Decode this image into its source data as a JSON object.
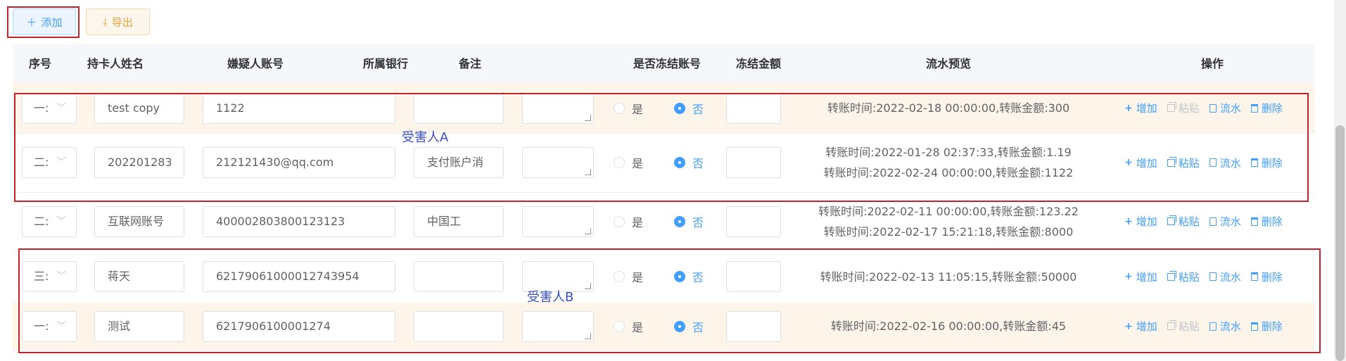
{
  "toolbar": {
    "add_label": "添加",
    "export_label": "导出"
  },
  "table": {
    "headers": {
      "index": "序号",
      "holder": "持卡人姓名",
      "account": "嫌疑人账号",
      "bank": "所属银行",
      "remark": "备注",
      "freeze_flag": "是否冻结账号",
      "freeze_amount": "冻结金额",
      "flow": "流水预览",
      "ops": "操作"
    },
    "radio_yes": "是",
    "radio_no": "否",
    "ops": {
      "add": "增加",
      "paste": "粘贴",
      "flow": "流水",
      "delete": "删除"
    },
    "rows": [
      {
        "index": "一:",
        "holder": "test copy",
        "account": "1122",
        "bank": "",
        "remark": "",
        "freeze": "否",
        "freeze_amount": "",
        "flows": [
          "转账时间:2022-02-18 00:00:00,转账金额:300"
        ],
        "paste_enabled": false
      },
      {
        "index": "二:",
        "holder": "202201283",
        "account": "212121430@qq.com",
        "bank": "支付账户消",
        "remark": "",
        "freeze": "否",
        "freeze_amount": "",
        "flows": [
          "转账时间:2022-01-28 02:37:33,转账金额:1.19",
          "转账时间:2022-02-24 00:00:00,转账金额:1122"
        ],
        "paste_enabled": true
      },
      {
        "index": "二:",
        "holder": "互联网账号",
        "account": "400002803800123123",
        "bank": "中国工",
        "remark": "",
        "freeze": "否",
        "freeze_amount": "",
        "flows": [
          "转账时间:2022-02-11 00:00:00,转账金额:123.22",
          "转账时间:2022-02-17 15:21:18,转账金额:8000"
        ],
        "paste_enabled": true
      },
      {
        "index": "三:",
        "holder": "蒋天",
        "account": "62179061000012743954",
        "bank": "",
        "remark": "",
        "freeze": "否",
        "freeze_amount": "",
        "flows": [
          "转账时间:2022-02-13 11:05:15,转账金额:50000"
        ],
        "paste_enabled": true
      },
      {
        "index": "一:",
        "holder": "测试",
        "account": "6217906100001274",
        "bank": "",
        "remark": "",
        "freeze": "否",
        "freeze_amount": "",
        "flows": [
          "转账时间:2022-02-16 00:00:00,转账金额:45"
        ],
        "paste_enabled": false
      }
    ]
  },
  "annotations": {
    "victim_a": "受害人A",
    "victim_b": "受害人B"
  },
  "colors": {
    "primary": "#409eff",
    "warning": "#e6a23c",
    "annotation_red": "#c0232b",
    "annotation_text": "#3b4fc4",
    "highlight_row": "#fdf5ea"
  }
}
